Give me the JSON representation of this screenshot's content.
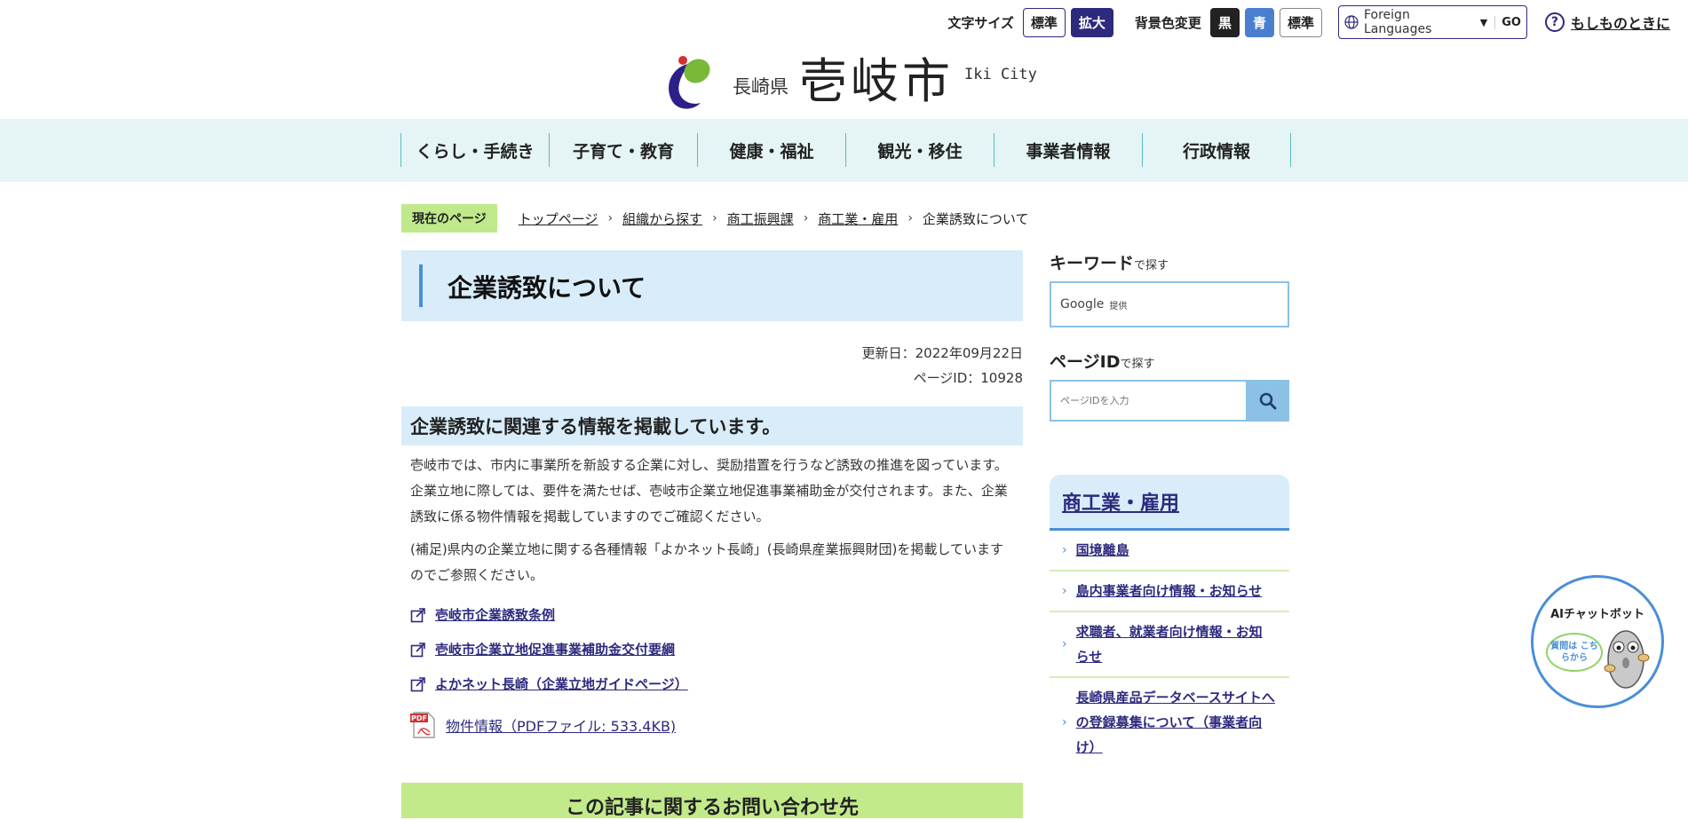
{
  "utility": {
    "font_size_label": "文字サイズ",
    "font_standard": "標準",
    "font_large": "拡大",
    "bg_label": "背景色変更",
    "bg_black": "黒",
    "bg_blue": "青",
    "bg_standard": "標準",
    "lang_label": "Foreign Languages",
    "lang_go": "GO",
    "help_label": "もしものときに"
  },
  "logo": {
    "prefecture": "長崎県",
    "city": "壱岐市",
    "english": "Iki City"
  },
  "nav": [
    "くらし・手続き",
    "子育て・教育",
    "健康・福祉",
    "観光・移住",
    "事業者情報",
    "行政情報"
  ],
  "breadcrumb": {
    "badge": "現在のページ",
    "links": [
      "トップページ",
      "組織から探す",
      "商工振興課",
      "商工業・雇用"
    ],
    "current": "企業誘致について"
  },
  "main": {
    "title": "企業誘致について",
    "updated": "更新日：2022年09月22日",
    "page_id": "ページID：10928",
    "heading": "企業誘致に関連する情報を掲載しています。",
    "paragraph1": " 壱岐市では、市内に事業所を新設する企業に対し、奨励措置を行うなど誘致の推進を図っています。企業立地に際しては、要件を満たせば、壱岐市企業立地促進事業補助金が交付されます。また、企業誘致に係る物件情報を掲載していますのでご確認ください。",
    "paragraph2": "(補足)県内の企業立地に関する各種情報「よかネット長崎」(長崎県産業振興財団)を掲載していますのでご参照ください。",
    "links": [
      "壱岐市企業誘致条例",
      "壱岐市企業立地促進事業補助金交付要綱",
      "よかネット長崎（企業立地ガイドページ）"
    ],
    "pdf_link": "物件情報（PDFファイル: 533.4KB)",
    "contact_heading": "この記事に関するお問い合わせ先"
  },
  "sidebar": {
    "keyword_title": "キーワード",
    "keyword_suffix": "で探す",
    "google_label": "Google",
    "google_provided": "提供",
    "pageid_title": "ページID",
    "pageid_suffix": "で探す",
    "pageid_placeholder": "ページIDを入力",
    "category_title": "商工業・雇用",
    "items": [
      "国境離島",
      "島内事業者向け情報・お知らせ",
      "求職者、就業者向け情報・お知らせ",
      "長崎県産品データベースサイトへの登録募集について（事業者向け）"
    ]
  },
  "chatbot": {
    "title": "AIチャットボット",
    "bubble": "質問は こちらから"
  }
}
